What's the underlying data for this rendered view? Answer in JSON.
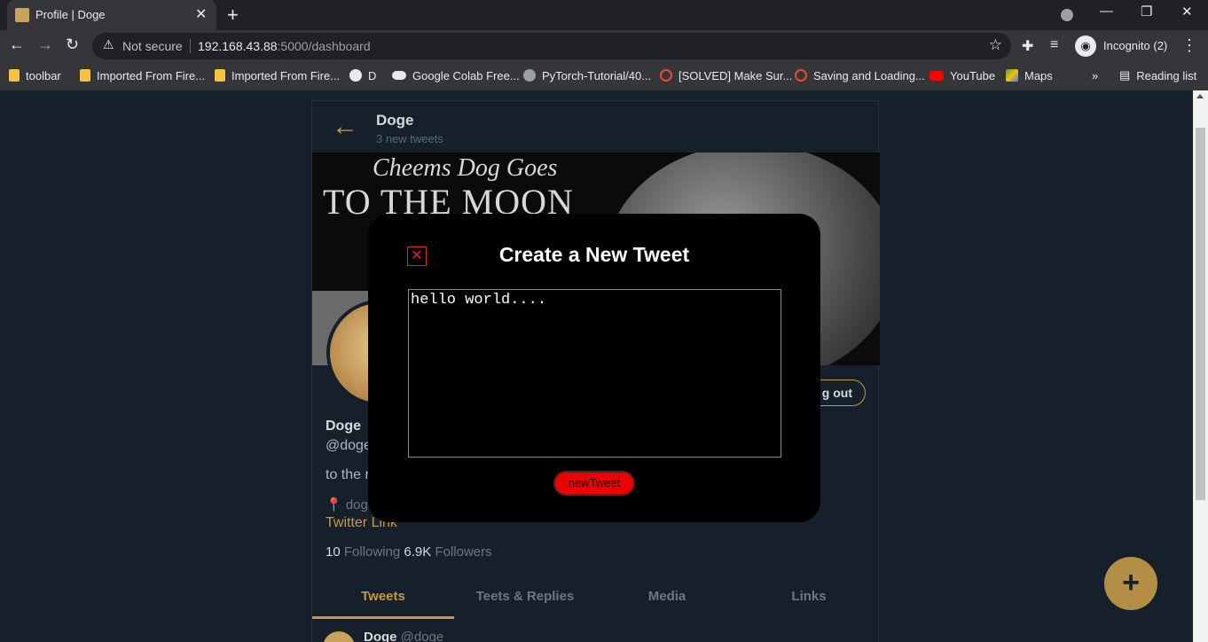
{
  "browser": {
    "tab_title": "Profile | Doge",
    "tab_close": "✕",
    "newtab": "+",
    "not_secure": "Not secure",
    "url_host": "192.168.43.88",
    "url_rest": ":5000/dashboard",
    "profile_label": "Incognito (2)",
    "bookmarks": [
      {
        "label": "toolbar",
        "icon": "folder-icon"
      },
      {
        "label": "Imported From Fire...",
        "icon": "folder-icon"
      },
      {
        "label": "Imported From Fire...",
        "icon": "folder-icon"
      },
      {
        "label": "D",
        "icon": "globe-icon"
      },
      {
        "label": "Google Colab Free...",
        "icon": "colab-icon"
      },
      {
        "label": "PyTorch-Tutorial/40...",
        "icon": "github-icon"
      },
      {
        "label": "[SOLVED] Make Sur...",
        "icon": "pytorch-icon"
      },
      {
        "label": "Saving and Loading...",
        "icon": "pytorch-icon"
      },
      {
        "label": "YouTube",
        "icon": "youtube-icon"
      },
      {
        "label": "Maps",
        "icon": "maps-icon"
      }
    ],
    "more_bookmarks": "»",
    "reading_list": "Reading list"
  },
  "profile": {
    "header_name": "Doge",
    "header_sub": "3 new tweets",
    "banner_line1": "Cheems Dog Goes",
    "banner_line2": "TO THE MOON",
    "logout_label": "g out",
    "name": "Doge",
    "handle": "@doge",
    "bio": "to the r",
    "location": "📍 doge",
    "link": "Twitter Link",
    "following_count": "10",
    "following_label": "Following",
    "followers_count": "6.9K",
    "followers_label": "Followers",
    "tabs": [
      "Tweets",
      "Teets & Replies",
      "Media",
      "Links"
    ],
    "peek_name": "Doge",
    "peek_handle": "@doge"
  },
  "modal": {
    "title": "Create a New Tweet",
    "close": "✕",
    "text_value": "hello world....",
    "submit_label": "newTweet"
  },
  "fab": "+",
  "colors": {
    "accent": "#c99a3d",
    "background": "#15202b",
    "submit": "#ee0000"
  }
}
